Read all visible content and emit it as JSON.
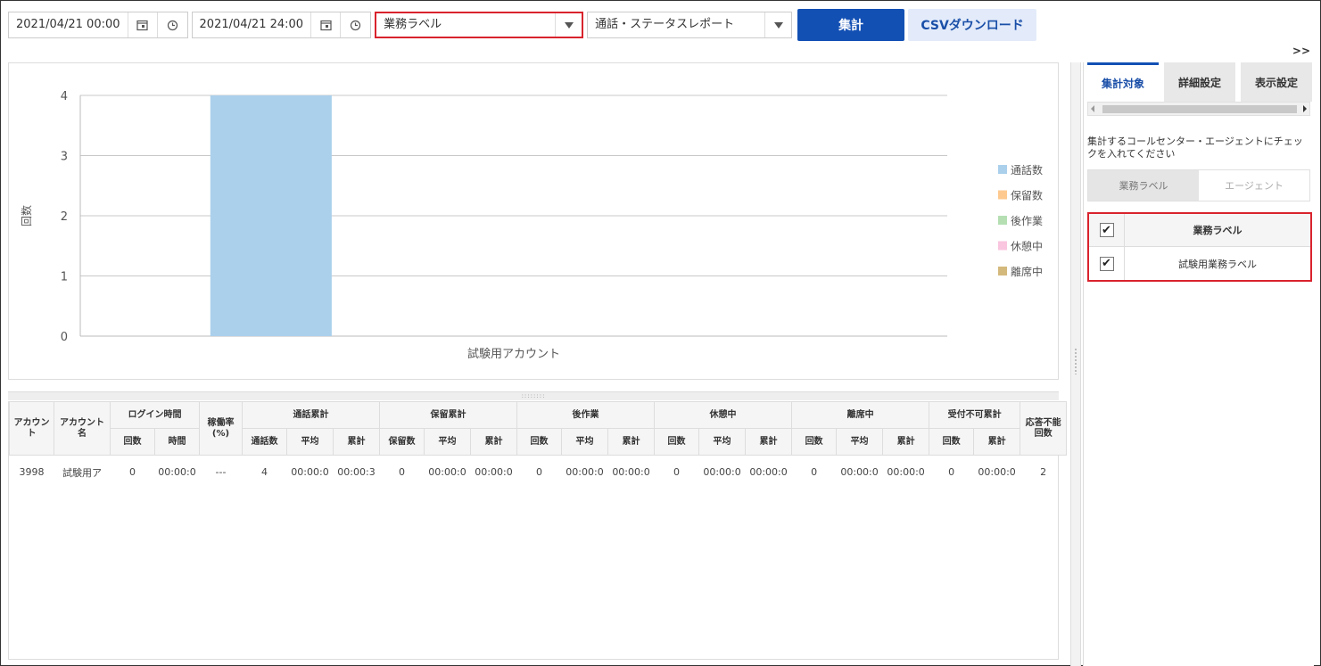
{
  "toolbar": {
    "start_datetime": "2021/04/21 00:00",
    "end_datetime": "2021/04/21 24:00",
    "group_select": "業務ラベル",
    "report_select": "通話・ステータスレポート",
    "aggregate_button": "集計",
    "csv_button": "CSVダウンロード",
    "calendar_icon": "calendar-icon",
    "clock_icon": "clock-icon"
  },
  "expand_label": ">>",
  "chart_data": {
    "type": "bar",
    "categories": [
      "試験用アカウント"
    ],
    "series": [
      {
        "name": "通話数",
        "values": [
          4
        ],
        "color": "#abd0ec"
      },
      {
        "name": "保留数",
        "values": [
          0
        ],
        "color": "#fec98f"
      },
      {
        "name": "後作業",
        "values": [
          0
        ],
        "color": "#b5dfb3"
      },
      {
        "name": "休憩中",
        "values": [
          0
        ],
        "color": "#f9c5df"
      },
      {
        "name": "離席中",
        "values": [
          0
        ],
        "color": "#d4b97d"
      }
    ],
    "yticks": [
      "0",
      "1",
      "2",
      "3",
      "4"
    ],
    "ylabel": "回数",
    "xlabel": "",
    "ylim": [
      0,
      4
    ],
    "grid": true,
    "legend": "right"
  },
  "table": {
    "groups": [
      {
        "label": "アカウント",
        "colspan": 1,
        "rowspan": 2
      },
      {
        "label": "アカウント名",
        "colspan": 1,
        "rowspan": 2
      },
      {
        "label": "ログイン時間",
        "colspan": 2,
        "rowspan": 1
      },
      {
        "label": "稼働率(%)",
        "colspan": 1,
        "rowspan": 2
      },
      {
        "label": "通話累計",
        "colspan": 3,
        "rowspan": 1
      },
      {
        "label": "保留累計",
        "colspan": 3,
        "rowspan": 1
      },
      {
        "label": "後作業",
        "colspan": 3,
        "rowspan": 1
      },
      {
        "label": "休憩中",
        "colspan": 3,
        "rowspan": 1
      },
      {
        "label": "離席中",
        "colspan": 3,
        "rowspan": 1
      },
      {
        "label": "受付不可累計",
        "colspan": 2,
        "rowspan": 1
      },
      {
        "label": "応答不能回数",
        "colspan": 1,
        "rowspan": 2
      }
    ],
    "subheaders": [
      "回数",
      "時間",
      "通話数",
      "平均",
      "累計",
      "保留数",
      "平均",
      "累計",
      "回数",
      "平均",
      "累計",
      "回数",
      "平均",
      "累計",
      "回数",
      "平均",
      "累計",
      "回数",
      "累計"
    ],
    "rows": [
      [
        "3998",
        "試験用ア",
        "0",
        "00:00:0",
        "---",
        "4",
        "00:00:0",
        "00:00:3",
        "0",
        "00:00:0",
        "00:00:0",
        "0",
        "00:00:0",
        "00:00:0",
        "0",
        "00:00:0",
        "00:00:0",
        "0",
        "00:00:0",
        "00:00:0",
        "0",
        "00:00:0",
        "2"
      ]
    ]
  },
  "right_panel": {
    "tabs": [
      "集計対象",
      "詳細設定",
      "表示設定"
    ],
    "active_tab": 0,
    "description": "集計するコールセンター・エージェントにチェックを入れてください",
    "subtabs": [
      "業務ラベル",
      "エージェント"
    ],
    "active_subtab": 0,
    "check_header": "業務ラベル",
    "check_items": [
      "試験用業務ラベル"
    ],
    "check_mark": "✔"
  }
}
